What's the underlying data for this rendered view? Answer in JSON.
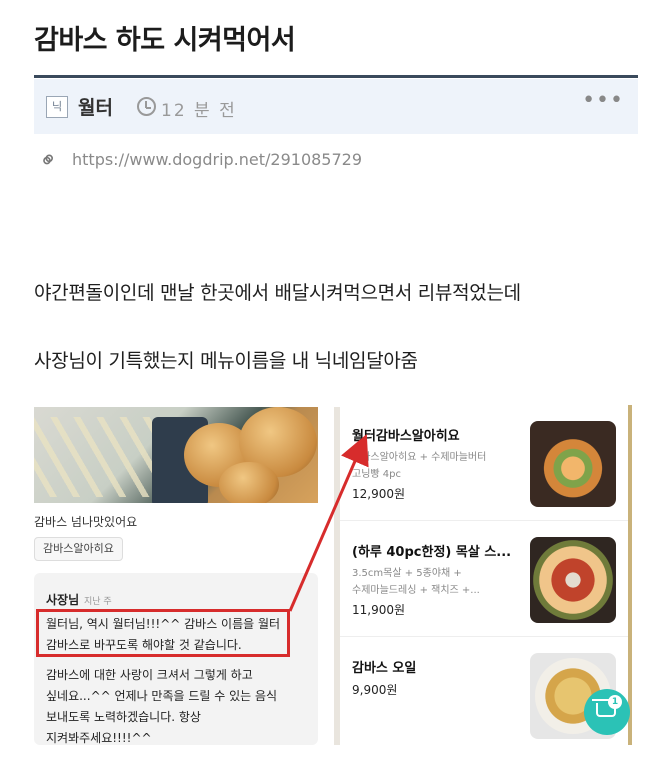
{
  "post": {
    "title": "감바스 하도 시켜먹어서",
    "author": "월터",
    "author_icon_glyph": "닉",
    "time": "12 분 전",
    "url": "https://www.dogdrip.net/291085729",
    "paragraphs": [
      "야간편돌이인데 맨날 한곳에서 배달시켜먹으면서 리뷰적었는데",
      "사장님이 기특했는지 메뉴이름을 내 닉네임달아줌"
    ]
  },
  "review": {
    "text": "감바스 넘나맛있어요",
    "menu_tag": "감바스알아히요",
    "owner": "사장님",
    "ago": "지난 주",
    "reply_lines": [
      "월터님, 역시 월터님!!!^^ 감바스 이름을 월터",
      "감바스로 바꾸도록 해야할 것 같습니다.",
      "감바스에 대한 사랑이 크셔서 그렇게 하고",
      "싶네요...^^ 언제나 만족을 드릴 수 있는 음식",
      "보내도록 노력하겠습니다. 항상",
      "지켜봐주세요!!!!^^"
    ]
  },
  "menu": [
    {
      "name": "월터감바스알아히요",
      "desc": [
        "감바스알아히요 + 수제마늘버터",
        "고닝빵 4pc"
      ],
      "price": "12,900원"
    },
    {
      "name": "(하루 40pc한정) 목살 스...",
      "desc": [
        "3.5cm목살 + 5종야채 +",
        "수제마늘드레싱 + 잭치즈 +..."
      ],
      "price": "11,900원"
    },
    {
      "name": "감바스 오일",
      "desc": [],
      "price": "9,900원"
    }
  ],
  "cart": {
    "count": "1"
  },
  "colors": {
    "accent_red": "#d72c2c",
    "cart_teal": "#2bc2b6",
    "meta_bg": "#eef3fa"
  },
  "icons": [
    "author-icon",
    "clock-icon",
    "more-icon",
    "link-icon",
    "cart-icon"
  ]
}
